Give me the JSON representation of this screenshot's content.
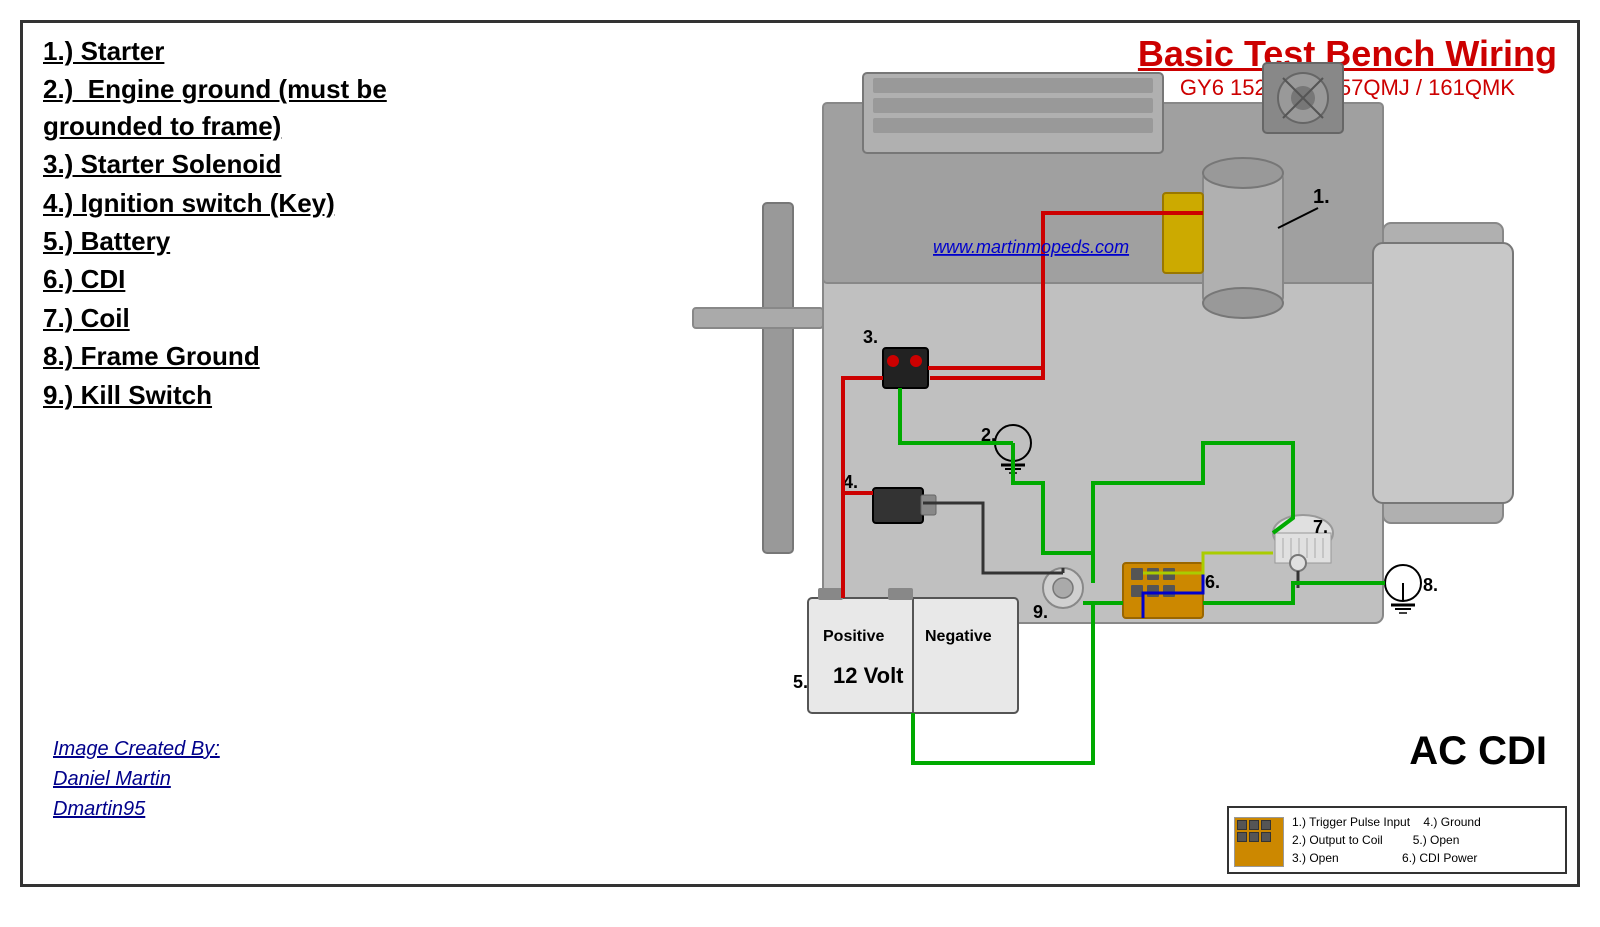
{
  "title": {
    "main": "Basic Test Bench Wiring",
    "sub": "GY6  152QMI / 157QMJ / 161QMK"
  },
  "components": [
    {
      "num": "1.)",
      "label": "Starter"
    },
    {
      "num": "2.)",
      "label": " Engine ground (must be grounded to frame)"
    },
    {
      "num": "3.)",
      "label": "Starter Solenoid"
    },
    {
      "num": "4.)",
      "label": "Ignition switch (Key)"
    },
    {
      "num": "5.)",
      "label": "Battery"
    },
    {
      "num": "6.)",
      "label": "CDI"
    },
    {
      "num": "7.)",
      "label": "Coil"
    },
    {
      "num": "8.)",
      "label": "Frame Ground"
    },
    {
      "num": "9.)",
      "label": "Kill Switch"
    }
  ],
  "credit": {
    "line1": "Image Created By:",
    "line2": "Daniel Martin",
    "line3": "Dmartin95"
  },
  "website": "www.martinmopeds.com",
  "ac_cdi_label": "AC CDI",
  "battery": {
    "positive": "Positive",
    "negative": "Negative",
    "voltage": "12 Volt"
  },
  "cdi_legend": {
    "items": [
      "1.) Trigger Pulse Input",
      "2.) Output to Coil",
      "3.) Open",
      "4.) Ground",
      "5.) Open",
      "6.) CDI Power"
    ]
  }
}
